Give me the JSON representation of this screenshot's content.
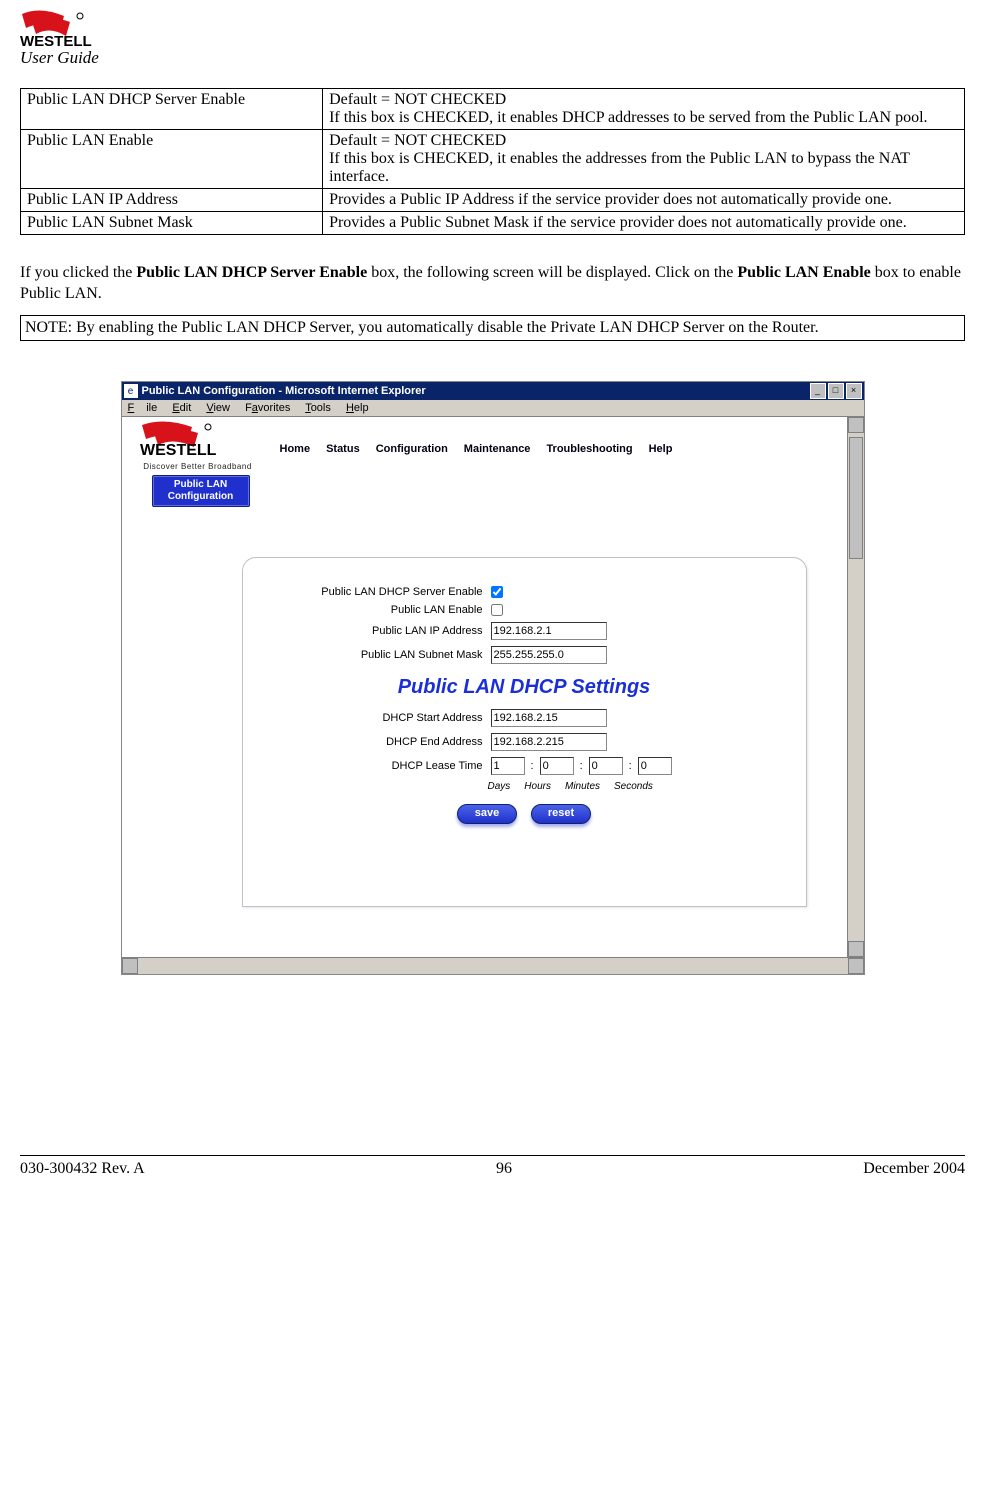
{
  "header": {
    "subtitle": "User Guide"
  },
  "def_table": {
    "rows": [
      {
        "name": "Public LAN DHCP Server Enable",
        "desc": "Default = NOT CHECKED\nIf this box is CHECKED, it enables DHCP addresses to be served from the Public LAN pool."
      },
      {
        "name": "Public LAN Enable",
        "desc": "Default = NOT CHECKED\nIf this box is CHECKED, it enables the addresses from the Public LAN to bypass the NAT interface."
      },
      {
        "name": "Public LAN IP Address",
        "desc": "Provides a Public IP Address if the service provider does not automatically provide one."
      },
      {
        "name": "Public LAN Subnet Mask",
        "desc": "Provides a Public Subnet Mask if the service provider does not automatically provide one."
      }
    ]
  },
  "paragraph": {
    "pre": "If you clicked the ",
    "b1": "Public LAN DHCP Server Enable",
    "mid": " box, the following screen will be displayed. Click on the ",
    "b2": "Public LAN Enable",
    "post": " box to enable Public LAN."
  },
  "note": "NOTE: By enabling the Public LAN DHCP Server, you automatically disable the Private LAN DHCP Server on the Router.",
  "screenshot": {
    "window_title": "Public LAN Configuration - Microsoft Internet Explorer",
    "menubar": [
      "File",
      "Edit",
      "View",
      "Favorites",
      "Tools",
      "Help"
    ],
    "tagline": "Discover Better Broadband",
    "nav": [
      "Home",
      "Status",
      "Configuration",
      "Maintenance",
      "Troubleshooting",
      "Help"
    ],
    "side_badge": {
      "line1": "Public LAN",
      "line2": "Configuration"
    },
    "form": {
      "rows": {
        "dhcp_server_enable": {
          "label": "Public LAN DHCP Server Enable",
          "checked": true
        },
        "lan_enable": {
          "label": "Public LAN Enable",
          "checked": false
        },
        "ip_address": {
          "label": "Public LAN IP Address",
          "value": "192.168.2.1"
        },
        "subnet_mask": {
          "label": "Public LAN Subnet Mask",
          "value": "255.255.255.0"
        }
      },
      "dhcp_heading": "Public LAN DHCP Settings",
      "dhcp": {
        "start": {
          "label": "DHCP Start Address",
          "value": "192.168.2.15"
        },
        "end": {
          "label": "DHCP End Address",
          "value": "192.168.2.215"
        },
        "lease": {
          "label": "DHCP Lease Time",
          "days": "1",
          "hours": "0",
          "minutes": "0",
          "seconds": "0",
          "unit_days": "Days",
          "unit_hours": "Hours",
          "unit_minutes": "Minutes",
          "unit_seconds": "Seconds"
        }
      },
      "buttons": {
        "save": "save",
        "reset": "reset"
      }
    }
  },
  "footer": {
    "left": "030-300432 Rev. A",
    "center": "96",
    "right": "December 2004"
  }
}
